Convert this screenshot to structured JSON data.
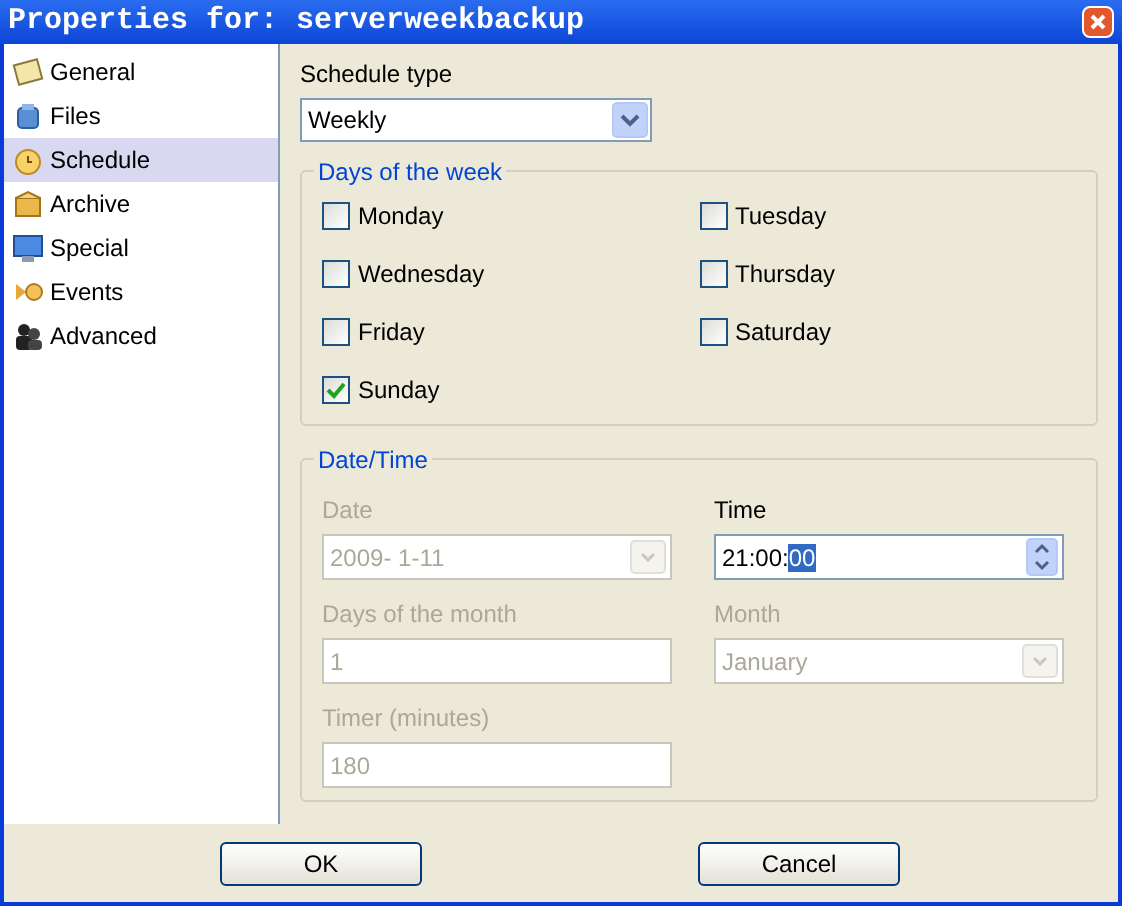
{
  "window": {
    "title": "Properties for: serverweekbackup"
  },
  "sidebar": {
    "items": [
      {
        "label": "General",
        "selected": false
      },
      {
        "label": "Files",
        "selected": false
      },
      {
        "label": "Schedule",
        "selected": true
      },
      {
        "label": "Archive",
        "selected": false
      },
      {
        "label": "Special",
        "selected": false
      },
      {
        "label": "Events",
        "selected": false
      },
      {
        "label": "Advanced",
        "selected": false
      }
    ]
  },
  "schedule_type": {
    "label": "Schedule type",
    "value": "Weekly"
  },
  "days_group": {
    "title": "Days of the week",
    "days": [
      {
        "label": "Monday",
        "checked": false
      },
      {
        "label": "Tuesday",
        "checked": false
      },
      {
        "label": "Wednesday",
        "checked": false
      },
      {
        "label": "Thursday",
        "checked": false
      },
      {
        "label": "Friday",
        "checked": false
      },
      {
        "label": "Saturday",
        "checked": false
      },
      {
        "label": "Sunday",
        "checked": true
      }
    ]
  },
  "datetime_group": {
    "title": "Date/Time",
    "fields": [
      {
        "kind": "dropdown",
        "label": "Date",
        "value": "2009-  1-11",
        "disabled": true
      },
      {
        "kind": "spinner",
        "label": "Time",
        "value": "21:00:",
        "selection": "00",
        "disabled": false
      },
      {
        "kind": "text",
        "label": "Days of the month",
        "value": "1",
        "disabled": true
      },
      {
        "kind": "dropdown",
        "label": "Month",
        "value": "January",
        "disabled": true
      },
      {
        "kind": "text",
        "label": "Timer (minutes)",
        "value": "180",
        "disabled": true
      }
    ]
  },
  "buttons": [
    {
      "label": "OK"
    },
    {
      "label": "Cancel"
    }
  ]
}
